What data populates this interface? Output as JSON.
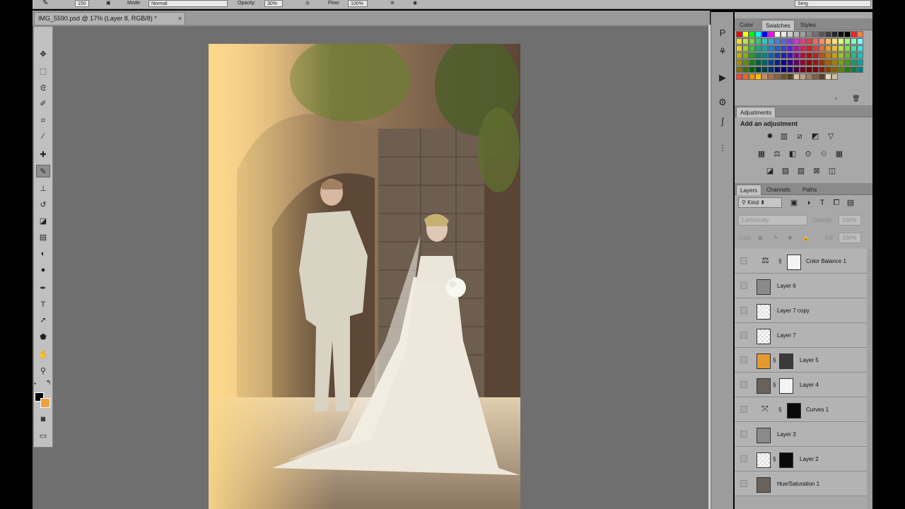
{
  "options_bar": {
    "brush_size": "150",
    "mode_label": "Mode:",
    "mode_value": "Normal",
    "opacity_label": "Opacity:",
    "opacity_value": "30%",
    "flow_label": "Flow:",
    "flow_value": "100%",
    "workspace": "Serg"
  },
  "document_tab": {
    "title": "IMG_5590.psd @ 17% (Layer 8, RGB/8) *",
    "close": "×"
  },
  "toolbox": {
    "tools": [
      "move-icon",
      "marquee-icon",
      "lasso-icon",
      "quick-select-icon",
      "crop-icon",
      "eyedropper-icon",
      "spot-healing-icon",
      "brush-icon",
      "clone-stamp-icon",
      "history-brush-icon",
      "eraser-icon",
      "gradient-icon",
      "blur-icon",
      "dodge-icon",
      "pen-icon",
      "type-icon",
      "path-select-icon",
      "shape-icon",
      "hand-icon",
      "zoom-icon"
    ],
    "active_tool": "brush-icon",
    "foreground_color": "#000000",
    "background_color": "#f0a040"
  },
  "color_panel": {
    "tabs": [
      "Color",
      "Swatches",
      "Styles"
    ],
    "active_tab": "Swatches"
  },
  "adjustments_panel": {
    "tab": "Adjustments",
    "title": "Add an adjustment",
    "row1": [
      "brightness-icon",
      "levels-icon",
      "curves-icon",
      "exposure-icon",
      "vibrance-icon"
    ],
    "row2": [
      "hue-sat-icon",
      "color-balance-icon",
      "black-white-icon",
      "photo-filter-icon",
      "channel-mixer-icon",
      "color-lookup-icon"
    ],
    "row3": [
      "invert-icon",
      "posterize-icon",
      "threshold-icon",
      "selective-color-icon",
      "gradient-map-icon"
    ]
  },
  "layers_panel": {
    "tabs": [
      "Layers",
      "Channels",
      "Paths"
    ],
    "active_tab": "Layers",
    "filter_kind": "Kind",
    "blend_mode": "Luminosity",
    "opacity_label": "Opacity:",
    "opacity_value": "100%",
    "lock_label": "Lock:",
    "fill_label": "Fill:",
    "fill_value": "100%",
    "layers": [
      {
        "name": "Color Balance 1",
        "kind": "adjustment",
        "symbol": "⚖"
      },
      {
        "name": "Layer 6",
        "kind": "gray"
      },
      {
        "name": "Layer 7 copy",
        "kind": "transparent"
      },
      {
        "name": "Layer 7",
        "kind": "transparent"
      },
      {
        "name": "Layer 5",
        "kind": "orange-mask"
      },
      {
        "name": "Layer 4",
        "kind": "photo-mask"
      },
      {
        "name": "Curves 1",
        "kind": "adjustment-dark",
        "symbol": "⤧"
      },
      {
        "name": "Layer 3",
        "kind": "gray"
      },
      {
        "name": "Layer 2",
        "kind": "transparent-dark"
      },
      {
        "name": "Hue/Saturation 1",
        "kind": "photo"
      }
    ]
  },
  "swatch_colors": [
    [
      "#ff0000",
      "#ffff00",
      "#00ff00",
      "#00ffff",
      "#0000ff",
      "#ff00ff",
      "#ffffff",
      "#e8e8e8",
      "#d0d0d0",
      "#b8b8b8",
      "#a0a0a0",
      "#888888",
      "#707070",
      "#585858",
      "#404040",
      "#282828",
      "#101010",
      "#000000",
      "#ff2020",
      "#ff8040"
    ],
    [
      "#f0e030",
      "#c0e040",
      "#80d040",
      "#40c080",
      "#40c0c0",
      "#40a0e0",
      "#4080e0",
      "#6060e0",
      "#8040e0",
      "#c040c0",
      "#e04080",
      "#e04040",
      "#ff6060",
      "#ff9060",
      "#ffc060",
      "#ffe080",
      "#e0ff80",
      "#a0ff80",
      "#80ffc0",
      "#80ffff"
    ],
    [
      "#e0d020",
      "#a0d020",
      "#40c040",
      "#20a080",
      "#20a0a0",
      "#2080d0",
      "#2060d0",
      "#4040d0",
      "#6020d0",
      "#a020a0",
      "#d02060",
      "#d02020",
      "#e04040",
      "#e07030",
      "#e0a030",
      "#e0c040",
      "#c0e040",
      "#80e040",
      "#40e0a0",
      "#40e0e0"
    ],
    [
      "#c0b010",
      "#80b010",
      "#20a020",
      "#108060",
      "#108080",
      "#1060b0",
      "#1040b0",
      "#2020b0",
      "#4010b0",
      "#801080",
      "#b01040",
      "#b01010",
      "#c02020",
      "#c05010",
      "#c08010",
      "#c0a020",
      "#a0c020",
      "#60c020",
      "#20c080",
      "#20c0c0"
    ],
    [
      "#a09000",
      "#609000",
      "#108010",
      "#006040",
      "#006060",
      "#004090",
      "#002090",
      "#100090",
      "#300090",
      "#600060",
      "#900030",
      "#900000",
      "#a01010",
      "#a03000",
      "#a06000",
      "#a08010",
      "#80a010",
      "#40a010",
      "#10a060",
      "#10a0a0"
    ],
    [
      "#807000",
      "#407000",
      "#006000",
      "#004030",
      "#004040",
      "#003070",
      "#001070",
      "#000070",
      "#200070",
      "#400040",
      "#700020",
      "#700000",
      "#800000",
      "#802000",
      "#804000",
      "#806000",
      "#608000",
      "#208000",
      "#008040",
      "#008080"
    ],
    [
      "#ff4040",
      "#ff6020",
      "#ff9000",
      "#ffc000",
      "#c89060",
      "#b07040",
      "#906030",
      "#705020",
      "#504020",
      "#e0c0a0",
      "#c0a080",
      "#a08060",
      "#806040",
      "#604020",
      "#e8d8c0",
      "#d0c0a0"
    ]
  ],
  "canvas": {
    "zoom": "17%"
  }
}
